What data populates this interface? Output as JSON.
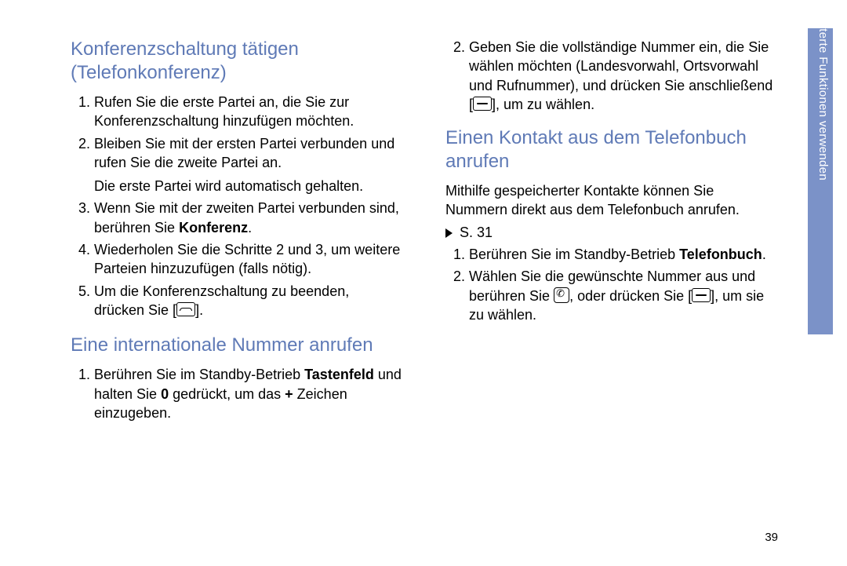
{
  "col1": {
    "h1": "Konferenzschaltung tätigen (Telefonkonferenz)",
    "l1_1": "Rufen Sie die erste Partei an, die Sie zur Konferenzschaltung hinzufügen möchten.",
    "l1_2": "Bleiben Sie mit der ersten Partei verbunden und rufen Sie die zweite Partei an.",
    "l1_2b": "Die erste Partei wird automatisch gehalten.",
    "l1_3a": "Wenn Sie mit der zweiten Partei verbunden sind, berühren Sie ",
    "l1_3b": "Konferenz",
    "l1_3c": ".",
    "l1_4": "Wiederholen Sie die Schritte 2 und 3, um weitere Parteien hinzuzufügen (falls nötig).",
    "l1_5a": "Um die Konferenzschaltung zu beenden, drücken Sie [",
    "l1_5b": "].",
    "h2": "Eine internationale Nummer anrufen",
    "l2_1a": "Berühren Sie im Standby-Betrieb ",
    "l2_1b": "Tastenfeld",
    "l2_1c": " und halten Sie ",
    "l2_1d": "0",
    "l2_1e": " gedrückt, um das ",
    "l2_1f": "+",
    "l2_1g": " Zeichen einzugeben."
  },
  "col2": {
    "l2_2a": "Geben Sie die vollständige Nummer ein, die Sie wählen möchten (Landesvorwahl, Ortsvorwahl und Rufnummer), und drücken Sie anschließend [",
    "l2_2b": "], um zu wählen.",
    "h3": "Einen Kontakt aus dem Telefonbuch anrufen",
    "p3a": "Mithilfe gespeicherter Kontakte können Sie Nummern direkt aus dem Telefonbuch anrufen.",
    "p3b": " S. 31",
    "l3_1a": "Berühren Sie im Standby-Betrieb ",
    "l3_1b": "Telefonbuch",
    "l3_1c": ".",
    "l3_2a": "Wählen Sie die gewünschte Nummer aus und berühren Sie ",
    "l3_2b": ", oder drücken Sie [",
    "l3_2c": "], um sie zu wählen."
  },
  "side": "Erweiterte Funktionen verwenden",
  "page": "39"
}
